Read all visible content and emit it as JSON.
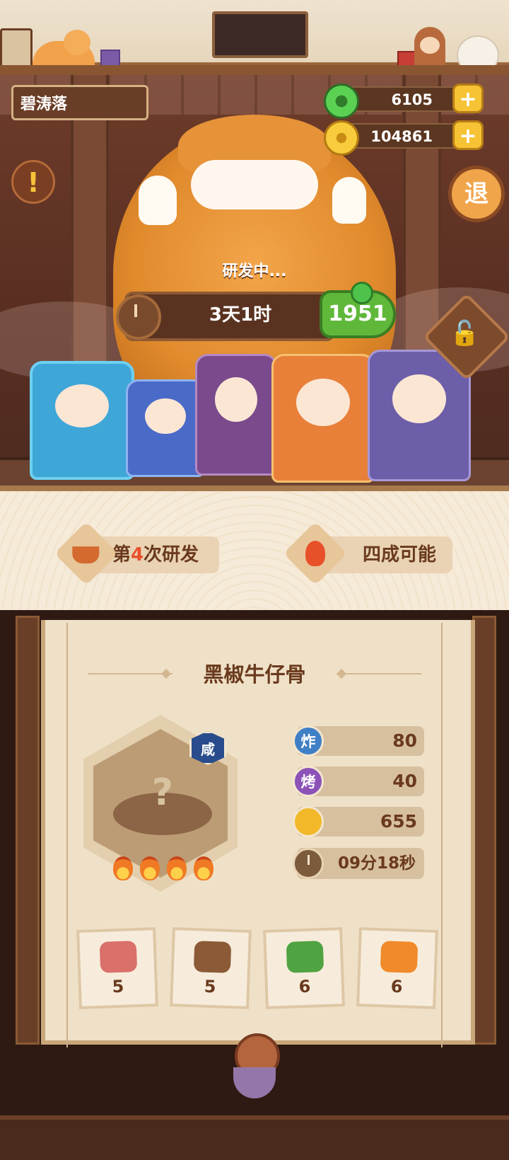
{
  "player": {
    "name": "碧涛落"
  },
  "currency": {
    "jade": {
      "icon": "jade-coin-icon",
      "value": "6105",
      "add_label": "+"
    },
    "gold": {
      "icon": "gold-coin-icon",
      "value": "104861",
      "add_label": "+"
    }
  },
  "buttons": {
    "alert_label": "!",
    "exit_label": "退",
    "lock_icon": "unlock-icon",
    "lock_glyph": "🔓"
  },
  "development": {
    "status": "研发中...",
    "remaining_time": "3天1时",
    "speedup_cost": "1951"
  },
  "info": {
    "attempt_prefix": "第",
    "attempt_number": "4",
    "attempt_suffix": "次研发",
    "chance": "四成可能"
  },
  "recipe": {
    "name": "黑椒牛仔骨",
    "taste_badge": "咸",
    "unknown_glyph": "?",
    "heat_level": 4,
    "stats": [
      {
        "key": "fry",
        "icon_label": "炸",
        "value": "80",
        "color": "#3f7fc6"
      },
      {
        "key": "roast",
        "icon_label": "烤",
        "value": "40",
        "color": "#8c52b8"
      },
      {
        "key": "coin",
        "icon_label": "",
        "value": "655",
        "color": "#f2b82a"
      }
    ],
    "time": "09分18秒",
    "ingredients": [
      {
        "name": "meat-icon",
        "count": "5",
        "color": "#d9706a"
      },
      {
        "name": "mushroom-icon",
        "count": "5",
        "color": "#8b5a36"
      },
      {
        "name": "cucumber-icon",
        "count": "6",
        "color": "#4fa342"
      },
      {
        "name": "carrot-icon",
        "count": "6",
        "color": "#f08a2a"
      }
    ]
  }
}
